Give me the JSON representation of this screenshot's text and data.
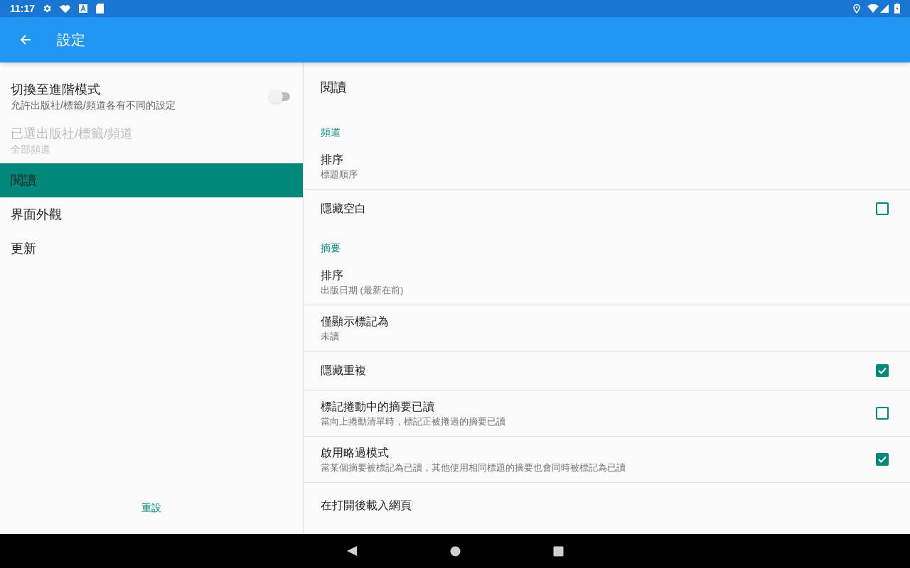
{
  "status_bar": {
    "time": "11:17"
  },
  "app_bar": {
    "title": "設定"
  },
  "sidebar": {
    "preferences": [
      {
        "title": "切換至進階模式",
        "summary": "允許出版社/標籤/頻道各有不同的設定",
        "kind": "switch",
        "on": false,
        "disabled": false
      },
      {
        "title": "已選出版社/標籤/頻道",
        "summary": "全部頻道",
        "kind": "plain",
        "disabled": true
      }
    ],
    "items": [
      {
        "label": "閱讀",
        "selected": true
      },
      {
        "label": "界面外觀",
        "selected": false
      },
      {
        "label": "更新",
        "selected": false
      }
    ],
    "reset_button": "重設"
  },
  "detail": {
    "items": [
      {
        "kind": "header",
        "title": "閱讀"
      },
      {
        "kind": "category",
        "title": "頻道"
      },
      {
        "kind": "plain",
        "title": "排序",
        "summary": "標題順序"
      },
      {
        "kind": "checkbox",
        "title": "隱藏空白",
        "checked": false
      },
      {
        "kind": "category",
        "title": "摘要"
      },
      {
        "kind": "plain",
        "title": "排序",
        "summary": "出版日期 (最新在前)"
      },
      {
        "kind": "plain",
        "title": "僅顯示標記為",
        "summary": "未讀"
      },
      {
        "kind": "checkbox",
        "title": "隱藏重複",
        "checked": true
      },
      {
        "kind": "checkbox",
        "title": "標記捲動中的摘要已讀",
        "summary": "當向上捲動清單時，標記正被捲過的摘要已讀",
        "checked": false
      },
      {
        "kind": "checkbox",
        "title": "啟用略過模式",
        "summary": "當某個摘要被標記為已讀，其他使用相同標題的摘要也會同時被標記為已讀",
        "checked": true
      },
      {
        "kind": "plain",
        "title": "在打開後載入網頁"
      }
    ]
  }
}
